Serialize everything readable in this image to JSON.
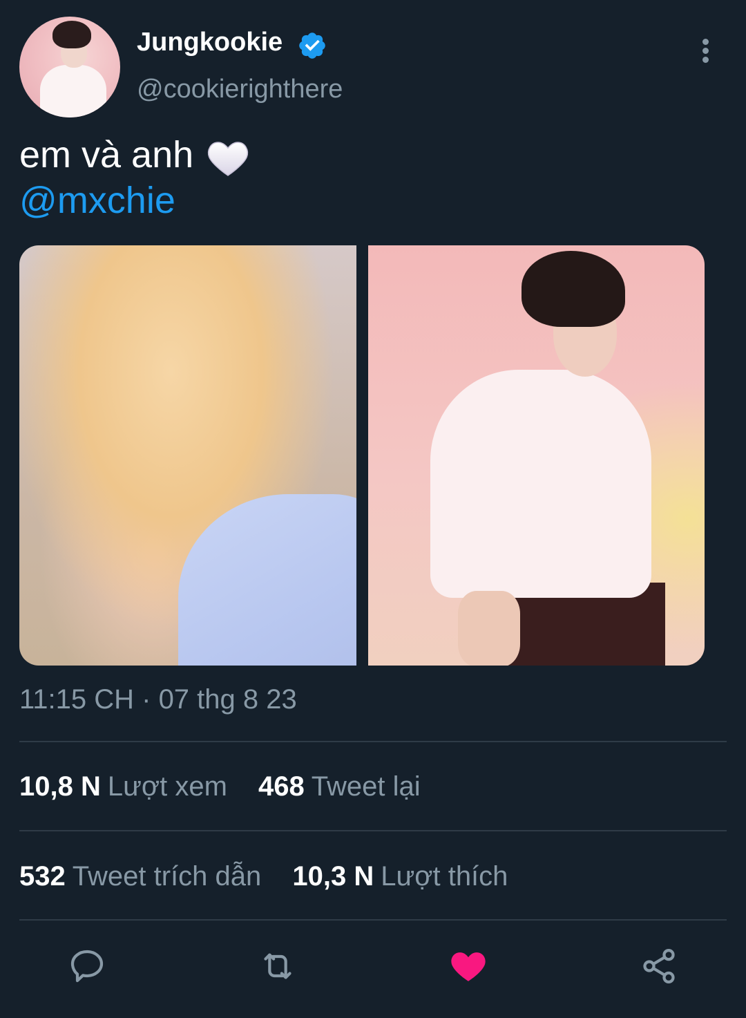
{
  "tweet": {
    "author_name": "Jungkookie",
    "author_handle": "@cookierighthere",
    "text": "em và anh",
    "emoji": "white-heart",
    "mention": "@mxchie",
    "timestamp": "11:15 CH · 07 thg 8 23"
  },
  "stats": {
    "views_count": "10,8 N",
    "views_label": "Lượt xem",
    "retweets_count": "468",
    "retweets_label": "Tweet lại",
    "quotes_count": "532",
    "quotes_label": "Tweet trích dẫn",
    "likes_count": "10,3 N",
    "likes_label": "Lượt thích"
  },
  "actions": {
    "reply_icon": "reply-icon",
    "retweet_icon": "retweet-icon",
    "like_icon": "heart-icon",
    "share_icon": "share-icon",
    "liked": true
  },
  "colors": {
    "background": "#15202b",
    "accent": "#1d9bf0",
    "secondary_text": "#8899a6",
    "like": "#f91880"
  }
}
